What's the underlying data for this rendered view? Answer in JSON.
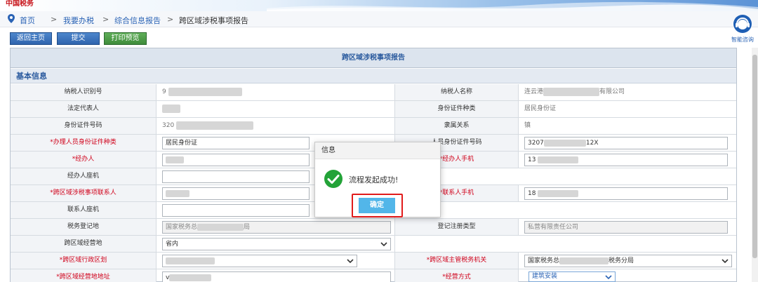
{
  "header": {
    "logo_text": "中国税务"
  },
  "breadcrumb": [
    "首页",
    "我要办税",
    "综合信息报告",
    "跨区域涉税事项报告"
  ],
  "breadcrumb_sep": ">",
  "help": {
    "label": "智能咨询"
  },
  "toolbar": {
    "back": "返回主页",
    "submit": "提交",
    "print": "打印预览"
  },
  "form": {
    "title": "跨区域涉税事项报告",
    "section": "基本信息",
    "labels": {
      "taxpayer_id": "纳税人识别号",
      "taxpayer_name": "纳税人名称",
      "legal_rep": "法定代表人",
      "id_type": "身份证件种类",
      "id_number": "身份证件号码",
      "relation": "隶属关系",
      "agent_id_type": "*办理人员身份证件种类",
      "agent_id_number_tail": "人员身份证件号码",
      "agent": "*经办人",
      "agent_phone": "*经办人手机",
      "agent_landline": "经办人座机",
      "contact": "*跨区域涉税事项联系人",
      "contact_phone": "*联系人手机",
      "contact_landline": "联系人座机",
      "tax_reg_office": "税务登记地",
      "reg_type": "登记注册类型",
      "cross_area": "跨区域经营地",
      "cross_admin": "*跨区域行政区划",
      "cross_tax_office": "*跨区域主管税务机关",
      "cross_address": "*跨区域经营地地址",
      "biz_mode": "*经营方式"
    },
    "values": {
      "taxpayer_id_prefix": "9",
      "taxpayer_name_prefix": "连云港",
      "taxpayer_name_suffix": "有限公司",
      "id_type": "居民身份证",
      "id_number_prefix": "320",
      "relation": "镇",
      "agent_id_type": "居民身份证",
      "agent_id_number_prefix": "3207",
      "agent_id_number_suffix": "12X",
      "agent_phone_prefix": "13",
      "contact_phone_prefix": "18",
      "tax_reg_office_prefix": "国家税务总",
      "tax_reg_office_suffix": "局",
      "reg_type": "私营有限责任公司",
      "cross_area": "省内",
      "cross_tax_office_prefix": "国家税务总",
      "cross_tax_office_suffix": "税务分局",
      "cross_address_prefix": "v",
      "biz_mode": "建筑安装"
    }
  },
  "dialog": {
    "title": "信息",
    "message": "流程发起成功!",
    "ok": "确定"
  }
}
